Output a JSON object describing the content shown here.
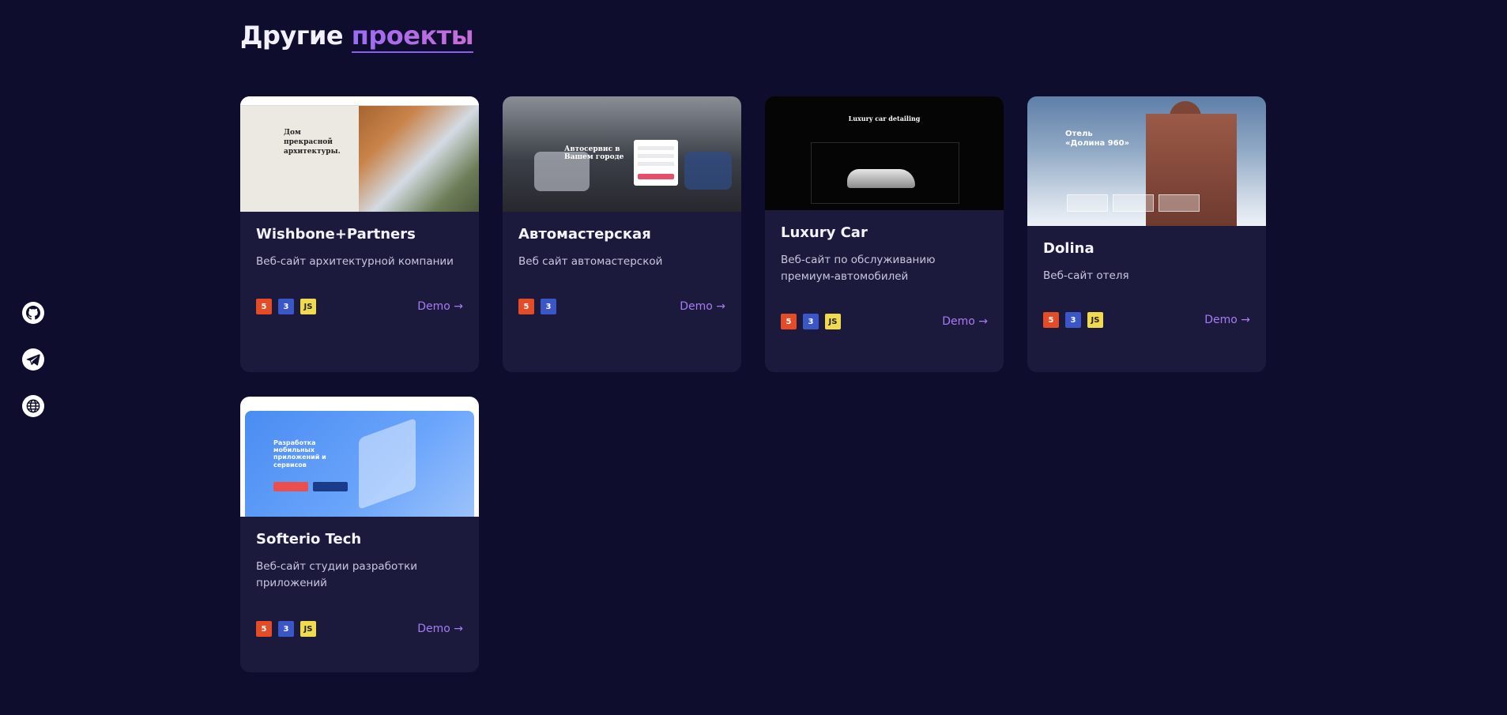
{
  "section": {
    "title_plain": "Другие",
    "title_accent": "проекты"
  },
  "social": [
    {
      "name": "github-icon"
    },
    {
      "name": "telegram-icon"
    },
    {
      "name": "globe-icon"
    }
  ],
  "cards": [
    {
      "title": "Wishbone+Partners",
      "desc": "Веб-сайт архитектурной компании",
      "tech": [
        "html5",
        "css3",
        "js"
      ],
      "demo": "Demo →",
      "thumb_text": "Дом прекрасной архитектуры."
    },
    {
      "title": "Автомастерская",
      "desc": "Веб сайт автомастерской",
      "tech": [
        "html5",
        "css3"
      ],
      "demo": "Demo →",
      "thumb_text": "Автосервис в Вашем городе"
    },
    {
      "title": "Luxury Car",
      "desc": "Веб-сайт по обслуживанию премиум-автомобилей",
      "tech": [
        "html5",
        "css3",
        "js"
      ],
      "demo": "Demo →",
      "thumb_text": "Luxury car detailing"
    },
    {
      "title": "Dolina",
      "desc": "Веб-сайт отеля",
      "tech": [
        "html5",
        "css3",
        "js"
      ],
      "demo": "Demo →",
      "thumb_text": "Отель «Долина 960»"
    },
    {
      "title": "Softerio Tech",
      "desc": "Веб-сайт студии разработки приложений",
      "tech": [
        "html5",
        "css3",
        "js"
      ],
      "demo": "Demo →",
      "thumb_text": "Разработка мобильных приложений и сервисов"
    }
  ],
  "colors": {
    "background": "#0e0d2e",
    "card": "#1b1a3d",
    "accent": "#a77bf3"
  }
}
